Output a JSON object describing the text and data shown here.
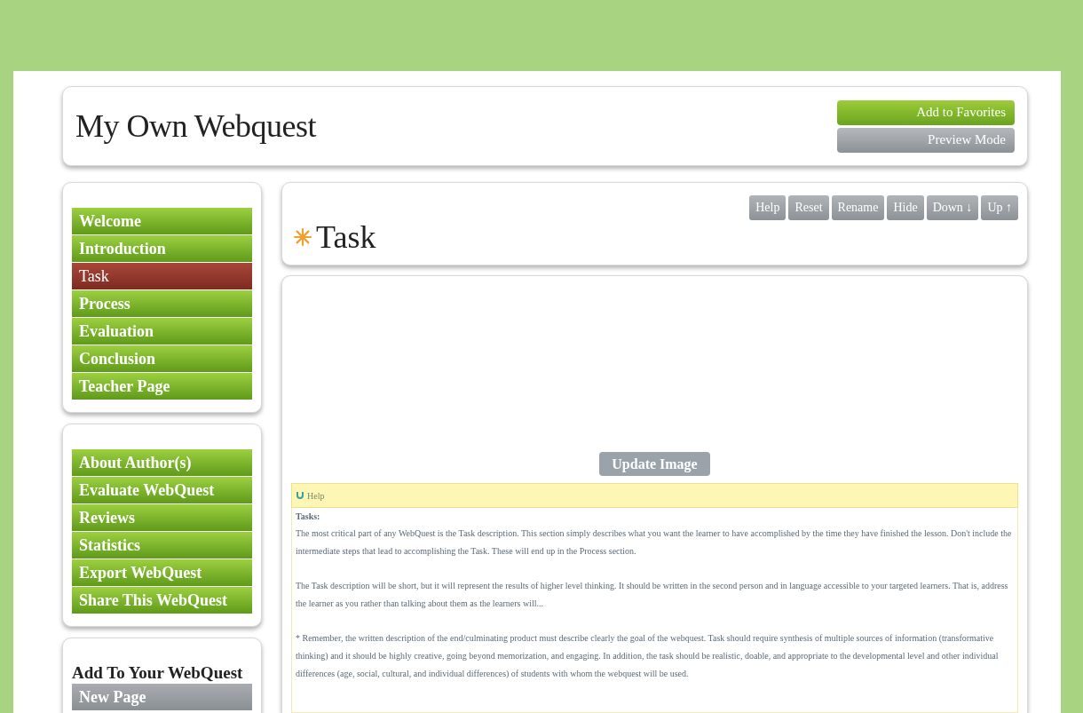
{
  "header": {
    "title": "My Own Webquest",
    "buttons": [
      {
        "label": "Add to Favorites",
        "kind": "green"
      },
      {
        "label": "Preview Mode",
        "kind": "gray"
      }
    ]
  },
  "nav": [
    {
      "label": "Welcome",
      "selected": false
    },
    {
      "label": "Introduction",
      "selected": false
    },
    {
      "label": "Task",
      "selected": true
    },
    {
      "label": "Process",
      "selected": false
    },
    {
      "label": "Evaluation",
      "selected": false
    },
    {
      "label": "Conclusion",
      "selected": false
    },
    {
      "label": "Teacher Page",
      "selected": false
    }
  ],
  "tools": [
    "About Author(s)",
    "Evaluate WebQuest",
    "Reviews",
    "Statistics",
    "Export WebQuest",
    "Share This WebQuest"
  ],
  "add_panel": {
    "title": "Add To Your WebQuest",
    "items": [
      "New Page"
    ]
  },
  "page": {
    "title": "Task",
    "actions": [
      "Help",
      "Reset",
      "Rename",
      "Hide",
      "Down ↓",
      "Up ↑"
    ],
    "update_button": "Update Image",
    "help": {
      "label": "Help",
      "heading": "Tasks:",
      "paragraphs": [
        "The most critical part of any WebQuest is the Task description. This section simply describes what you want the learner to have accomplished by the time they have finished the lesson. Don't include the intermediate steps that lead to accomplishing the Task. These will end up in the Process section.",
        "The Task description will be short, but it will represent the results of higher level thinking. It should be written in the second person and in language accessible to your targeted learners. That is, address the learner as you rather than talking about them as the learners will...",
        "* Remember, the written description of the end/culminating product must describe clearly the goal of the webquest. Task should require synthesis of multiple sources of information (transformative thinking) and it should be highly creative, going beyond memorization, and engaging. In addition, the task should be realistic, doable, and appropriate to the developmental level and other individual differences (age, social, cultural, and individual differences) of students with whom the webquest will be used."
      ]
    }
  }
}
